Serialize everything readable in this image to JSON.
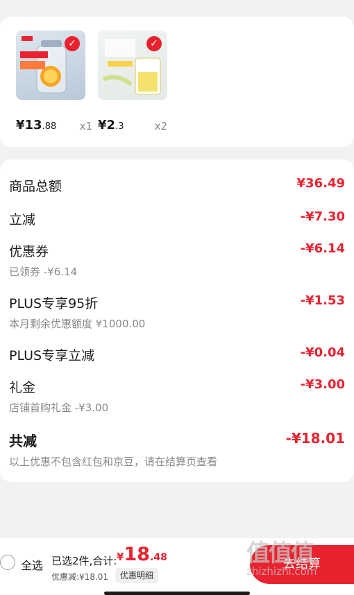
{
  "header": {
    "title_fragment": "...结算..."
  },
  "products": [
    {
      "price_int": "¥13",
      "price_dec": ".88",
      "qty": "x1",
      "selected": true,
      "icon": "check-icon"
    },
    {
      "price_int": "¥2",
      "price_dec": ".3",
      "qty": "x2",
      "selected": true,
      "icon": "check-icon"
    }
  ],
  "summary": {
    "goods_total": {
      "label": "商品总额",
      "amount": "¥36.49"
    },
    "instant_reduce": {
      "label": "立减",
      "amount": "-¥7.30"
    },
    "coupon": {
      "label": "优惠券",
      "amount": "-¥6.14",
      "sub": "已领券 -¥6.14"
    },
    "plus_95": {
      "label": "PLUS专享95折",
      "amount": "-¥1.53",
      "sub": "本月剩余优惠额度 ¥1000.00"
    },
    "plus_reduce": {
      "label": "PLUS专享立减",
      "amount": "-¥0.04"
    },
    "gift": {
      "label": "礼金",
      "amount": "-¥3.00",
      "sub": "店铺首购礼金 -¥3.00"
    },
    "total_reduce": {
      "label": "共减",
      "amount": "-¥18.01",
      "sub": "以上优惠不包含红包和京豆，请在结算页查看"
    }
  },
  "bottom": {
    "select_all": "全选",
    "selected_text": "已选2件,合计:",
    "currency": "¥",
    "total_int": "18",
    "total_dec": ".48",
    "discount_text": "优惠减:¥18.01",
    "detail_button": "优惠明细",
    "checkout_button": "去结算"
  },
  "watermark": {
    "logo": "值值值",
    "url": "zhizhizhi.com"
  },
  "colors": {
    "accent": "#e8232f",
    "background": "#f2f2f2",
    "card": "#ffffff"
  }
}
